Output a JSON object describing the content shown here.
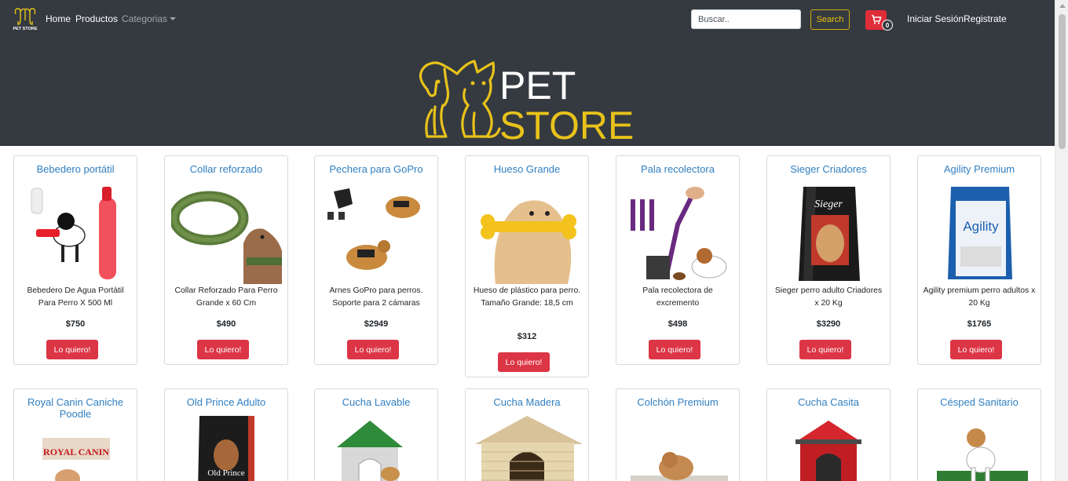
{
  "navbar": {
    "brand_text": "PET STORE",
    "links": {
      "home": "Home",
      "productos": "Productos",
      "categorias": "Categorias"
    },
    "search": {
      "placeholder": "Buscar..",
      "value": "",
      "button": "Search"
    },
    "cart": {
      "count": "0"
    },
    "login": "Iniciar Sesión",
    "register": "Registrate"
  },
  "hero": {
    "logo_text_line1": "PET",
    "logo_text_line2": "STORE"
  },
  "colors": {
    "navbar_bg": "#343a40",
    "brand_yellow": "#f1c40f",
    "title_blue": "#2f7fc1",
    "button_red": "#dc3545"
  },
  "products_row1": [
    {
      "title": "Bebedero portátil",
      "desc": "Bebedero De Agua Portátil Para Perro X 500 Ml",
      "price": "$750",
      "button": "Lo quiero!"
    },
    {
      "title": "Collar reforzado",
      "desc": "Collar Reforzado Para Perro Grande x 60 Cm",
      "price": "$490",
      "button": "Lo quiero!"
    },
    {
      "title": "Pechera para GoPro",
      "desc": "Arnes GoPro para perros. Soporte para 2 cámaras",
      "price": "$2949",
      "button": "Lo quiero!"
    },
    {
      "title": "Hueso Grande",
      "desc": "Hueso de plástico para perro. Tamaño Grande: 18,5 cm",
      "price": "$312",
      "button": "Lo quiero!"
    },
    {
      "title": "Pala recolectora",
      "desc": "Pala recolectora de excremento",
      "price": "$498",
      "button": "Lo quiero!"
    },
    {
      "title": "Sieger Criadores",
      "desc": "Sieger perro adulto Criadores x 20 Kg",
      "price": "$3290",
      "button": "Lo quiero!"
    },
    {
      "title": "Agility Premium",
      "desc": "Agility premium perro adultos x 20 Kg",
      "price": "$1765",
      "button": "Lo quiero!"
    }
  ],
  "products_row2": [
    {
      "title": "Royal Canin Caniche Poodle",
      "img_text": "ROYAL CANIN"
    },
    {
      "title": "Old Prince Adulto",
      "img_text": "Old Prince"
    },
    {
      "title": "Cucha Lavable"
    },
    {
      "title": "Cucha Madera"
    },
    {
      "title": "Colchón Premium"
    },
    {
      "title": "Cucha Casita"
    },
    {
      "title": "Césped Sanitario"
    }
  ],
  "package_labels": {
    "sieger": "Sieger",
    "agility": "Agility"
  }
}
